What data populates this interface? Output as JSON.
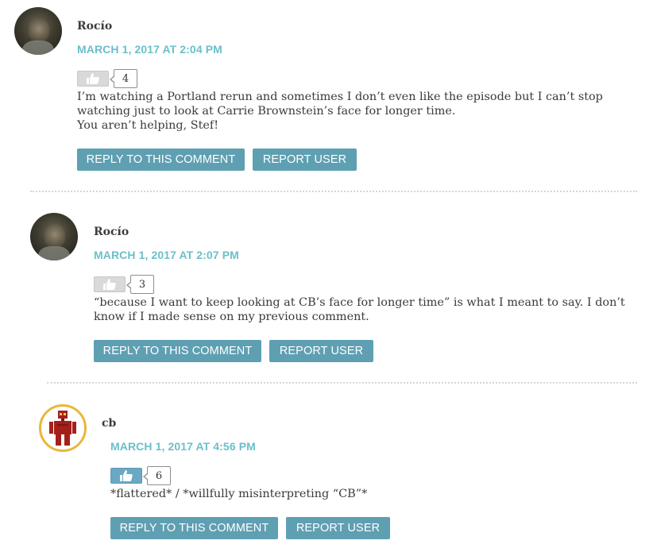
{
  "colors": {
    "accent_date": "#6bbfca",
    "button_bg": "#5f9fb2",
    "like_active": "#6aa8c4",
    "like_inactive": "#d9d9d9",
    "robot_ring": "#e8b73c",
    "robot_body": "#a51f1a"
  },
  "comments": [
    {
      "author": "Rocío",
      "avatar": "user-photo",
      "date": "MARCH 1, 2017 AT 2:04 PM",
      "likes": "4",
      "like_state": "inactive",
      "body": [
        "I’m watching a Portland rerun and sometimes I don’t even like the episode but I can’t stop watching just to look at Carrie Brownstein’s face for longer time.",
        "You aren’t helping, Stef!"
      ],
      "reply_label": "REPLY TO THIS COMMENT",
      "report_label": "REPORT USER"
    },
    {
      "author": "Rocío",
      "avatar": "user-photo",
      "date": "MARCH 1, 2017 AT 2:07 PM",
      "likes": "3",
      "like_state": "inactive",
      "body": [
        "“because I want to keep looking at CB’s face for longer time” is what I meant to say. I don’t know if I made sense on my previous comment."
      ],
      "reply_label": "REPLY TO THIS COMMENT",
      "report_label": "REPORT USER"
    },
    {
      "author": "cb",
      "avatar": "robot-icon",
      "date": "MARCH 1, 2017 AT 4:56 PM",
      "likes": "6",
      "like_state": "active",
      "body": [
        "*flattered* / *willfully misinterpreting “CB”*"
      ],
      "reply_label": "REPLY TO THIS COMMENT",
      "report_label": "REPORT USER"
    }
  ]
}
